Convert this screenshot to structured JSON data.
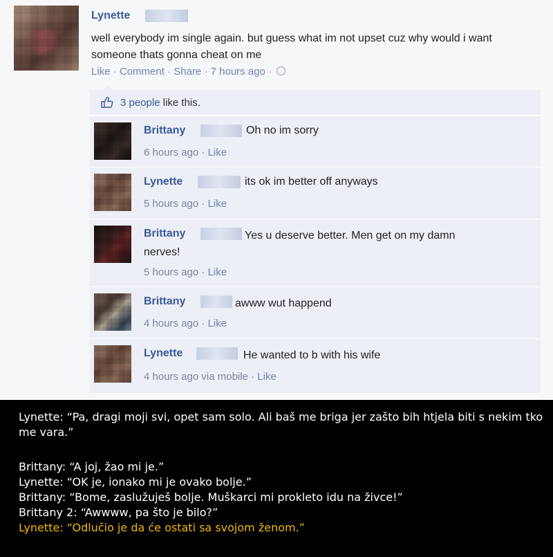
{
  "post": {
    "author": "Lynette",
    "text": "well everybody im single again. but guess what im not upset cuz why would i want someone thats gonna cheat on me",
    "actions": {
      "like": "Like",
      "comment": "Comment",
      "share": "Share",
      "sep": " · "
    },
    "time": "7 hours ago",
    "icon": "globe-icon"
  },
  "likes": {
    "count_text": "3 people",
    "suffix": " like this.",
    "icon": "thumbs-up-icon"
  },
  "comments": [
    {
      "author": "Brittany",
      "text": "Oh no im sorry",
      "time": "6 hours ago",
      "like": "Like"
    },
    {
      "author": "Lynette",
      "text": "its ok im better off anyways",
      "time": "5 hours ago",
      "like": "Like"
    },
    {
      "author": "Brittany",
      "text": "Yes u deserve better. Men get on my damn",
      "text2": "nerves!",
      "time": "5 hours ago",
      "like": "Like"
    },
    {
      "author": "Brittany",
      "text": "awww wut happend",
      "time": "4 hours ago",
      "like": "Like"
    },
    {
      "author": "Lynette",
      "text": "He wanted to b with his wife",
      "time": "4 hours ago via mobile",
      "like": "Like"
    }
  ],
  "caption": {
    "line1": "Lynette: “Pa, dragi moji svi, opet sam solo. Ali baš me briga jer zašto bih htjela biti s nekim tko me vara.”",
    "line2": "Brittany: “A joj, žao mi je.”",
    "line3": "Lynette: “OK je, ionako mi je ovako bolje.”",
    "line4": "Brittany: “Bome, zaslužuješ bolje. Muškarci mi prokleto idu na živce!”",
    "line5": "Brittany 2: “Awwww, pa što je bilo?”",
    "line6": "Lynette: “Odlučio je da će ostati sa svojom ženom.”",
    "highlight_color": "#f2b705"
  },
  "colors": {
    "link": "#3b5998",
    "meta": "#7b86a0",
    "comment_bg": "#eceff5"
  }
}
